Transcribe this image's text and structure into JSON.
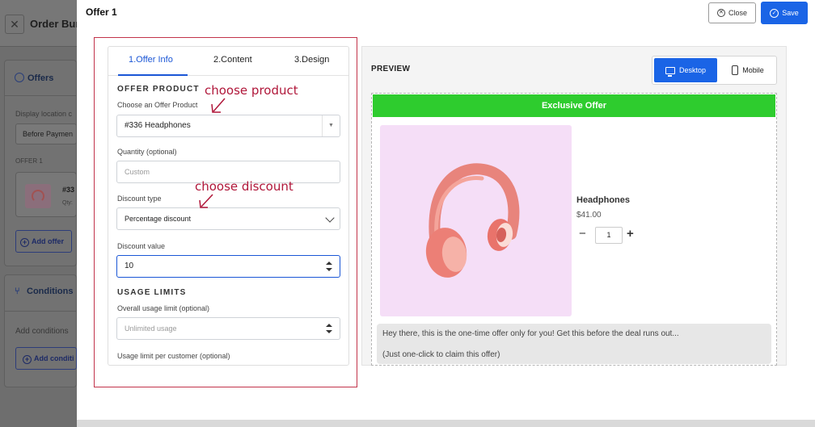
{
  "background": {
    "header_title": "Order Bum",
    "offers_section": {
      "title": "Offers",
      "display_location_label": "Display location c",
      "display_location_value": "Before Paymen",
      "offer_group_label": "OFFER 1",
      "offer_item_id": "#33",
      "offer_item_qty": "Qty:",
      "add_offer_label": "Add offer"
    },
    "conditions_section": {
      "title": "Conditions",
      "add_conditions_label": "Add conditions",
      "add_condition_button": "Add conditi"
    }
  },
  "modal": {
    "title": "Offer 1",
    "close_label": "Close",
    "save_label": "Save",
    "tabs": [
      {
        "label": "1.Offer Info",
        "active": true
      },
      {
        "label": "2.Content",
        "active": false
      },
      {
        "label": "3.Design",
        "active": false
      }
    ],
    "offer_product": {
      "section_title": "OFFER PRODUCT",
      "choose_label": "Choose an Offer Product",
      "choose_value": "#336 Headphones",
      "quantity_label": "Quantity (optional)",
      "quantity_placeholder": "Custom",
      "discount_type_label": "Discount type",
      "discount_type_value": "Percentage discount",
      "discount_value_label": "Discount value",
      "discount_value": "10"
    },
    "usage_limits": {
      "section_title": "USAGE LIMITS",
      "overall_label": "Overall usage limit (optional)",
      "overall_placeholder": "Unlimited usage",
      "per_customer_label": "Usage limit per customer (optional)"
    },
    "annotations": {
      "product": "choose product",
      "discount": "choose discount"
    },
    "preview": {
      "title": "PREVIEW",
      "desktop_label": "Desktop",
      "mobile_label": "Mobile",
      "banner": "Exclusive Offer",
      "product_name": "Headphones",
      "product_price": "$41.00",
      "quantity": "1",
      "message_line1": "Hey there, this is the one-time offer only for you! Get this before the deal runs out...",
      "message_line2": "(Just one-click to claim this offer)"
    }
  },
  "colors": {
    "accent": "#1a64e6",
    "banner_green": "#2ecc2e",
    "annotation_red": "#b0173a",
    "product_bg": "#f5def7"
  }
}
